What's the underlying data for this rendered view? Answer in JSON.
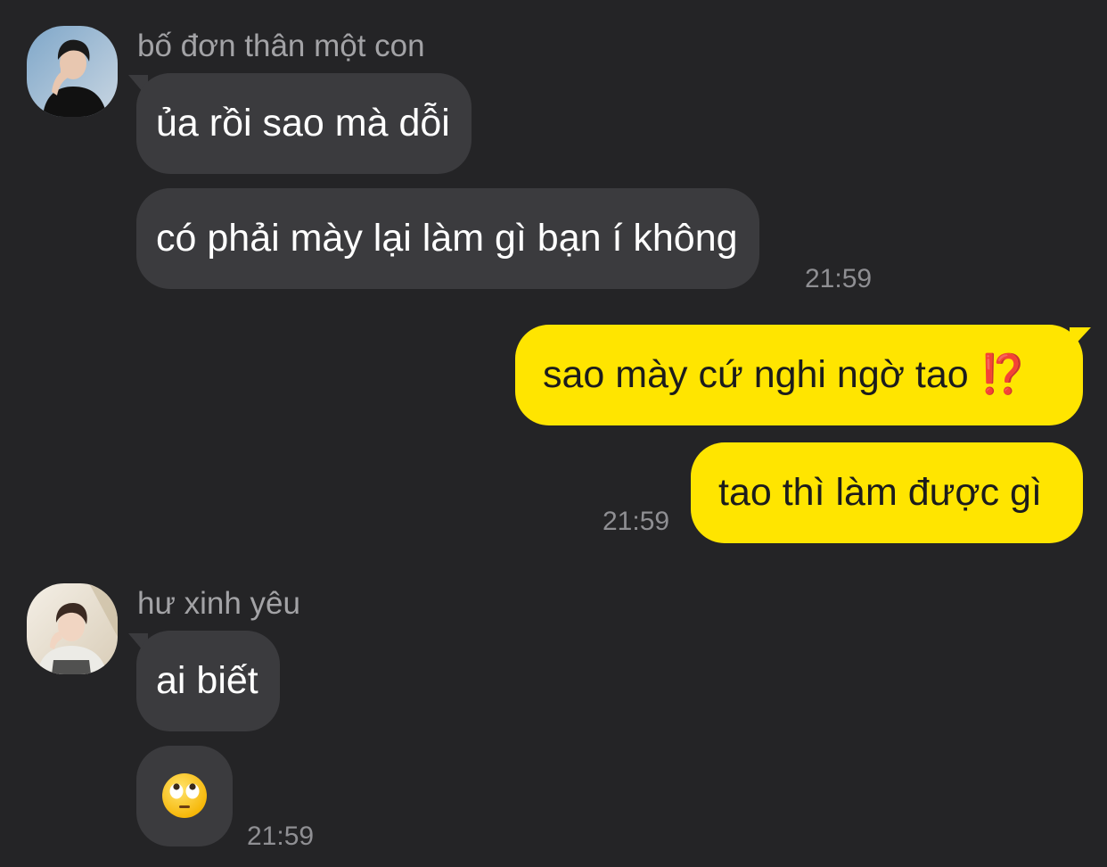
{
  "conversation": {
    "group1": {
      "sender": "bố đơn thân một con",
      "messages": [
        "ủa rồi sao mà dỗi",
        "có phải mày lại làm gì bạn í không"
      ],
      "time": "21:59"
    },
    "group2": {
      "messages": [
        "sao mày cứ nghi ngờ tao ⁉️",
        "tao thì làm được gì"
      ],
      "time": "21:59"
    },
    "group3": {
      "sender": "hư xinh yêu",
      "messages": [
        "ai biết"
      ],
      "emoji": "face-with-rolling-eyes-emoji",
      "time": "21:59"
    }
  },
  "colors": {
    "background": "#242426",
    "incoming_bubble": "#3b3b3e",
    "outgoing_bubble": "#ffe500",
    "sender_name": "#a3a3a6",
    "timestamp": "#8f8f93"
  }
}
